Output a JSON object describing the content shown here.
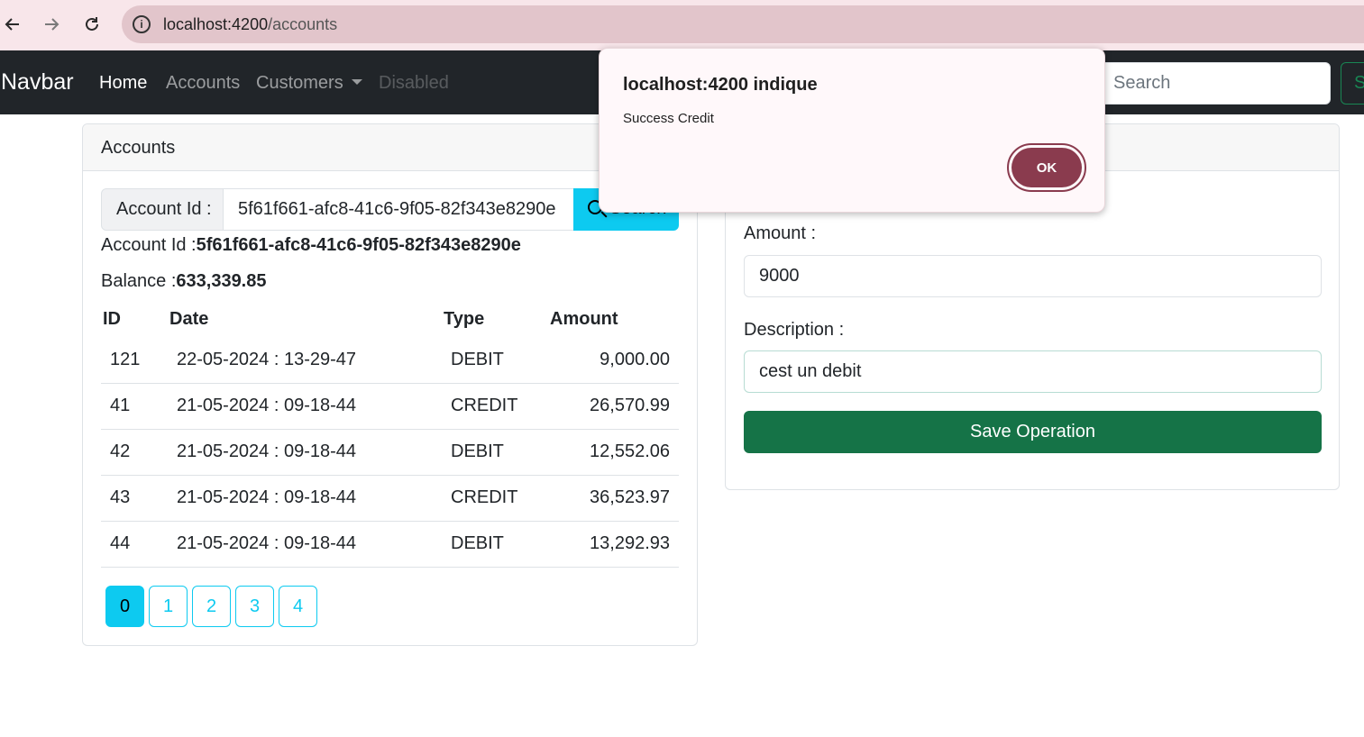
{
  "browser": {
    "url_host": "localhost:4200",
    "url_path": "/accounts"
  },
  "navbar": {
    "brand": "Navbar",
    "links": [
      {
        "label": "Home",
        "state": "active"
      },
      {
        "label": "Accounts",
        "state": "normal"
      },
      {
        "label": "Customers",
        "state": "dropdown"
      },
      {
        "label": "Disabled",
        "state": "disabled"
      }
    ],
    "search_placeholder": "Search",
    "search_button": "S"
  },
  "accounts_card": {
    "header": "Accounts",
    "search_label": "Account Id :",
    "search_value": "5f61f661-afc8-41c6-9f05-82f343e8290e",
    "search_button": "Search",
    "account_id_label": "Account Id :",
    "account_id_value": "5f61f661-afc8-41c6-9f05-82f343e8290e",
    "balance_label": "Balance :",
    "balance_value": "633,339.85",
    "table": {
      "headers": [
        "ID",
        "Date",
        "Type",
        "Amount"
      ],
      "rows": [
        {
          "id": "121",
          "date": "22-05-2024 : 13-29-47",
          "type": "DEBIT",
          "amount": "9,000.00"
        },
        {
          "id": "41",
          "date": "21-05-2024 : 09-18-44",
          "type": "CREDIT",
          "amount": "26,570.99"
        },
        {
          "id": "42",
          "date": "21-05-2024 : 09-18-44",
          "type": "DEBIT",
          "amount": "12,552.06"
        },
        {
          "id": "43",
          "date": "21-05-2024 : 09-18-44",
          "type": "CREDIT",
          "amount": "36,523.97"
        },
        {
          "id": "44",
          "date": "21-05-2024 : 09-18-44",
          "type": "DEBIT",
          "amount": "13,292.93"
        }
      ]
    },
    "pages": [
      "0",
      "1",
      "2",
      "3",
      "4"
    ],
    "active_page": "0"
  },
  "operation_card": {
    "amount_label": "Amount :",
    "amount_value": "9000",
    "description_label": "Description :",
    "description_value": "cest un debit",
    "save_button": "Save Operation"
  },
  "alert": {
    "title": "localhost:4200 indique",
    "message": "Success Credit",
    "ok_button": "OK"
  },
  "colors": {
    "info": "#0dcaf0",
    "success": "#157347",
    "navbar_bg": "#212529",
    "dialog_accent": "#8a3b4e"
  }
}
